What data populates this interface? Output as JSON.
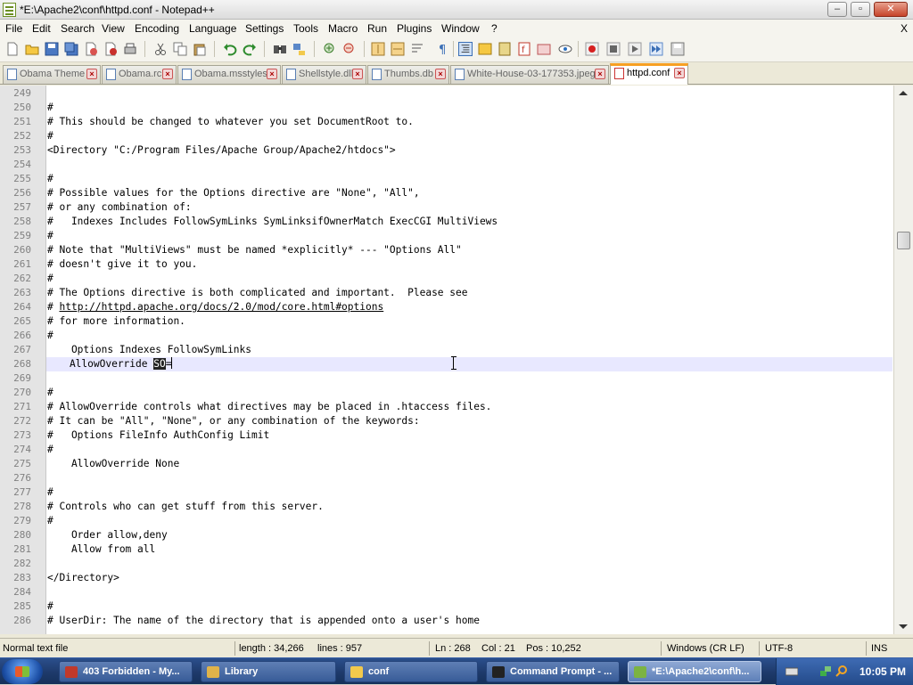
{
  "window": {
    "title": "*E:\\Apache2\\conf\\httpd.conf - Notepad++",
    "controls": {
      "minimize": "–",
      "maximize": "▫",
      "close": "✕"
    }
  },
  "menubar": {
    "items": [
      "File",
      "Edit",
      "Search",
      "View",
      "Encoding",
      "Language",
      "Settings",
      "Tools",
      "Macro",
      "Run",
      "Plugins",
      "Window",
      "?"
    ],
    "close_doc": "X"
  },
  "toolbar": {
    "buttons": [
      "new-file",
      "open-file",
      "save",
      "save-all",
      "close",
      "close-all",
      "print",
      "cut",
      "copy",
      "paste",
      "undo",
      "redo",
      "find",
      "replace",
      "zoom-in",
      "zoom-out",
      "sync-v",
      "sync-h",
      "word-wrap",
      "show-all-chars",
      "indent-guide",
      "user-language",
      "doc-map",
      "function-list",
      "folder-workspace",
      "monitor",
      "record-macro",
      "stop-macro",
      "play-macro",
      "run-macro-multiple",
      "save-macro"
    ]
  },
  "tabs": [
    {
      "label": "Obama Theme",
      "active": false
    },
    {
      "label": "Obama.rci",
      "active": false
    },
    {
      "label": "Obama.msstyles",
      "active": false
    },
    {
      "label": "Shellstyle.dll",
      "active": false
    },
    {
      "label": "Thumbs.db",
      "active": false
    },
    {
      "label": "White-House-03-177353.jpeg",
      "active": false
    },
    {
      "label": "httpd.conf",
      "active": true
    }
  ],
  "editor": {
    "lines": [
      {
        "n": "249",
        "t": ""
      },
      {
        "n": "250",
        "t": "#"
      },
      {
        "n": "251",
        "t": "# This should be changed to whatever you set DocumentRoot to."
      },
      {
        "n": "252",
        "t": "#"
      },
      {
        "n": "253",
        "t": "<Directory \"C:/Program Files/Apache Group/Apache2/htdocs\">"
      },
      {
        "n": "254",
        "t": ""
      },
      {
        "n": "255",
        "t": "#"
      },
      {
        "n": "256",
        "t": "# Possible values for the Options directive are \"None\", \"All\","
      },
      {
        "n": "257",
        "t": "# or any combination of:"
      },
      {
        "n": "258",
        "t": "#   Indexes Includes FollowSymLinks SymLinksifOwnerMatch ExecCGI MultiViews"
      },
      {
        "n": "259",
        "t": "#"
      },
      {
        "n": "260",
        "t": "# Note that \"MultiViews\" must be named *explicitly* --- \"Options All\""
      },
      {
        "n": "261",
        "t": "# doesn't give it to you."
      },
      {
        "n": "262",
        "t": "#"
      },
      {
        "n": "263",
        "t": "# The Options directive is both complicated and important.  Please see"
      },
      {
        "n": "264",
        "t": "# ",
        "url": "http://httpd.apache.org/docs/2.0/mod/core.html#options"
      },
      {
        "n": "265",
        "t": "# for more information."
      },
      {
        "n": "266",
        "t": "#"
      },
      {
        "n": "267",
        "t": "    Options Indexes FollowSymLinks"
      },
      {
        "n": "268",
        "t": "    AllowOverride ",
        "sel": "SO",
        "after": "="
      },
      {
        "n": "269",
        "t": ""
      },
      {
        "n": "270",
        "t": "#"
      },
      {
        "n": "271",
        "t": "# AllowOverride controls what directives may be placed in .htaccess files."
      },
      {
        "n": "272",
        "t": "# It can be \"All\", \"None\", or any combination of the keywords:"
      },
      {
        "n": "273",
        "t": "#   Options FileInfo AuthConfig Limit"
      },
      {
        "n": "274",
        "t": "#"
      },
      {
        "n": "275",
        "t": "    AllowOverride None"
      },
      {
        "n": "276",
        "t": ""
      },
      {
        "n": "277",
        "t": "#"
      },
      {
        "n": "278",
        "t": "# Controls who can get stuff from this server."
      },
      {
        "n": "279",
        "t": "#"
      },
      {
        "n": "280",
        "t": "    Order allow,deny"
      },
      {
        "n": "281",
        "t": "    Allow from all"
      },
      {
        "n": "282",
        "t": ""
      },
      {
        "n": "283",
        "t": "</Directory>"
      },
      {
        "n": "284",
        "t": ""
      },
      {
        "n": "285",
        "t": "#"
      },
      {
        "n": "286",
        "t": "# UserDir: The name of the directory that is appended onto a user's home"
      }
    ],
    "current_line": "268"
  },
  "statusbar": {
    "file_type": "Normal text file",
    "length": "length : 34,266",
    "lines": "lines : 957",
    "ln": "Ln : 268",
    "col": "Col : 21",
    "pos": "Pos : 10,252",
    "eol": "Windows (CR LF)",
    "encoding": "UTF-8",
    "mode": "INS"
  },
  "taskbar": {
    "items": [
      {
        "label": "403 Forbidden - My...",
        "icon_color": "#c0392b",
        "active": false
      },
      {
        "label": "Library",
        "icon_color": "#e0b34a",
        "active": false
      },
      {
        "label": "conf",
        "icon_color": "#f2c94c",
        "active": false
      },
      {
        "label": "Command Prompt - ...",
        "icon_color": "#222222",
        "active": false
      },
      {
        "label": "*E:\\Apache2\\conf\\h...",
        "icon_color": "#7cb342",
        "active": true
      }
    ],
    "clock": "10:05 PM"
  }
}
